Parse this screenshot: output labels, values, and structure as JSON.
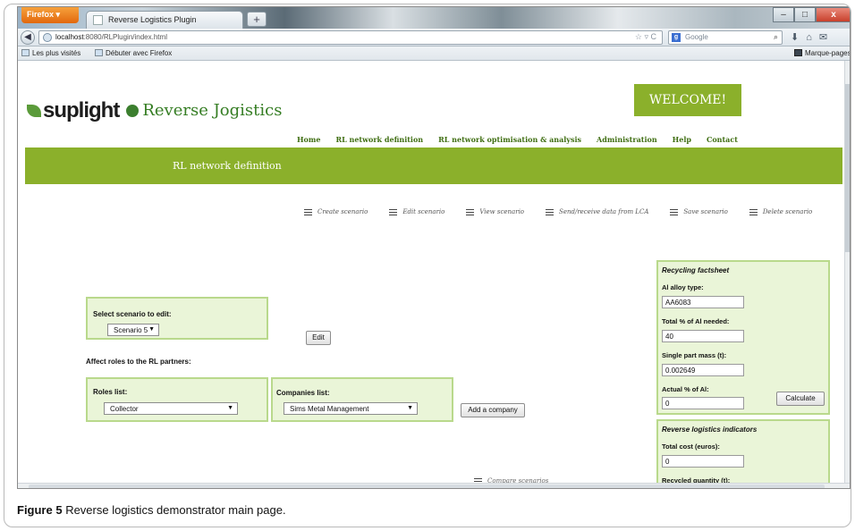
{
  "browser": {
    "app_button": "Firefox",
    "tab_title": "Reverse Logistics Plugin",
    "new_tab": "+",
    "url_host": "localhost",
    "url_rest": ":8080/RLPlugin/index.html",
    "search_placeholder": "Google",
    "search_engine_letter": "g",
    "bookmarks": [
      "Les plus visités",
      "Débuter avec Firefox"
    ],
    "bookmarks_menu": "Marque-pages",
    "window_controls": [
      "–",
      "□",
      "x"
    ]
  },
  "site": {
    "brand": "suplight",
    "subtitle": "Reverse Jogistics",
    "welcome": "WELCOME!",
    "menu": [
      "Home",
      "RL network definition",
      "RL network optimisation & analysis",
      "Administration",
      "Help",
      "Contact"
    ],
    "banner_title": "RL network definition",
    "actions": [
      "Create scenario",
      "Edit scenario",
      "View scenario",
      "Send/receive data from LCA",
      "Save scenario",
      "Delete scenario"
    ]
  },
  "edit": {
    "select_label": "Select scenario to edit:",
    "select_value": "Scenario 5",
    "edit_button": "Edit",
    "affect_label": "Affect roles to the RL partners:",
    "roles_label": "Roles list:",
    "roles_value": "Collector",
    "companies_label": "Companies list:",
    "companies_value": "Sims Metal Management",
    "add_company_button": "Add a company",
    "compare_label": "Compare scenarios"
  },
  "factsheet": {
    "title": "Recycling factsheet",
    "alloy_label": "Al alloy type:",
    "alloy_value": "AA6083",
    "total_label": "Total % of Al needed:",
    "total_value": "40",
    "mass_label": "Single part mass (t):",
    "mass_value": "0.002649",
    "actual_label": "Actual % of Al:",
    "actual_value": "0",
    "calculate_button": "Calculate"
  },
  "indicators": {
    "title": "Reverse logistics indicators",
    "cost_label": "Total cost (euros):",
    "cost_value": "0",
    "recycled_label": "Recycled quantity (t):"
  },
  "caption": {
    "label": "Figure 5",
    "text": " Reverse logistics demonstrator main page."
  }
}
